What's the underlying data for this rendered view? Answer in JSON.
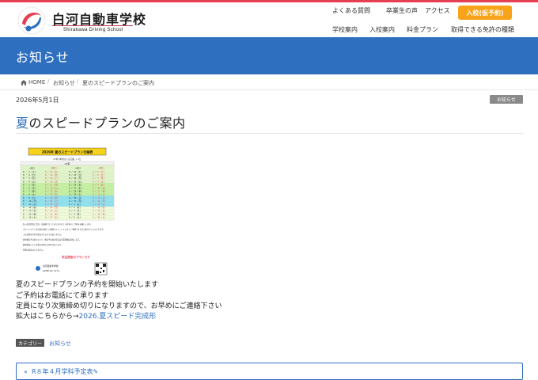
{
  "brand": {
    "name_jp": "白河自動車学校",
    "name_en": "Shirakawa Driving School",
    "colors": {
      "red": "#e53f53",
      "blue": "#2f6fc0",
      "orange": "#f8a319"
    }
  },
  "utility_nav": [
    "よくある質問",
    "卒業生の声",
    "アクセス"
  ],
  "cta_label": "入校(仮予約)",
  "global_nav": [
    "学校案内",
    "入校案内",
    "料金プラン",
    "取得できる免許の種類"
  ],
  "banner_title": "お知らせ",
  "breadcrumb": {
    "home_icon": "home-icon",
    "items": [
      "HOME",
      "お知らせ",
      "夏のスピードプランのご案内"
    ]
  },
  "post": {
    "date": "2026年5月1日",
    "category_badge": "お知らせ",
    "title_accent": "夏",
    "title_rest": "のスピードプランのご案内",
    "body": [
      "夏のスピードプランの予約を開始いたします",
      "ご予約はお電話にて承ります",
      "定員になり次第締め切りになりますので、お早めにご連絡下さい"
    ],
    "link_prefix": "拡大はこちらから→",
    "link_text": "2026.夏スピード完成形",
    "category_label": "カテゴリー",
    "category_value": "お知らせ"
  },
  "prev_post": {
    "arrow": "«",
    "title": "R８年４月学科予定表✎"
  },
  "flyer": {
    "title": "2026年 夏のスピードプラン日程表",
    "subtitle": "AT車の料金は下記記載 ＋ 2日",
    "column_header": "AT車",
    "left_headers": [
      "入校日",
      "仮免日"
    ],
    "right_headers": [
      "入校日",
      "卒業日"
    ],
    "rows": [
      [
        "8 ・ 1 (土)",
        "8 / 13 (木)",
        "8 / 22 (土)",
        "9 / 5 (土)"
      ],
      [
        "8 ・ 2 (日)",
        "8 / 14 (金)",
        "8 / 23 (日)",
        "9 / 6 (日)"
      ],
      [
        "8 ・ 3 (月)",
        "8 / 15 (土)",
        "8 / 24 (月)",
        "9 / 7 (月)"
      ],
      [
        "8 ・ 4 (火)",
        "8 / 16 (日)",
        "8 / 25 (火)",
        "9 / 8 (火)"
      ],
      [
        "8 ・ 5 (水)",
        "8 / 17 (月)",
        "8 / 26 (水)",
        "9 / 9 (水)"
      ],
      [
        "8 ・ 6 (木)",
        "8 / 18 (火)",
        "8 / 27 (木)",
        "9 / 10 (木)"
      ],
      [
        "8 ・ 7 (金)",
        "8 / 19 (水)",
        "8 / 28 (金)",
        "9 / 11 (金)"
      ],
      [
        "8 ・ 8 (土)",
        "8 / 20 (木)",
        "8 / 29 (土)",
        "9 / 12 (土)"
      ],
      [
        "8 ・ 9 (日)",
        "8 / 21 (金)",
        "8 / 30 (日)",
        "9 / 13 (日)"
      ],
      [
        "8 ・ 10 (月)",
        "8 / 22 (土)",
        "8 / 31 (月)",
        "9 / 14 (月)"
      ],
      [
        "8 ・ 11 (火)",
        "8 / 23 (日)",
        "9 / 1 (火)",
        "9 / 15 (火)"
      ],
      [
        "8 ・ 12 (水)",
        "8 / 24 (月)",
        "9 / 2 (水)",
        "9 / 16 (水)"
      ],
      [
        "8 ・ 13 (木)",
        "8 / 25 (火)",
        "9 / 3 (木)",
        "9 / 17 (木)"
      ],
      [
        "8 ・ 14 (金)",
        "8 / 26 (水)",
        "9 / 4 (金)",
        "9 / 18 (金)"
      ],
      [
        "8 ・ 15 (土)",
        "8 / 27 (木)",
        "9 / 5 (土)",
        "9 / 19 (土)"
      ]
    ],
    "notes": [
      "・ 各入校日程毎に定員・先着順となっておりますので お早めのご予約をお願いします。",
      "・ スピードプランは当校の指定した教習スケジュールに沿って 教習できる方に限らせていただきます。",
      "・ 上記日程は予定を保証するものではありません。",
      "・ 仮免検定不合格となった・検定不合格の場合は卒業期間は延長します。",
      "・ 教習進度により卒業日が異なる場合があります。",
      "・ 時間の指定はできません。"
    ],
    "student_plan": "学生限定のプランです",
    "school_name": "白河自動車学校",
    "phone": "0248-22-7171"
  }
}
